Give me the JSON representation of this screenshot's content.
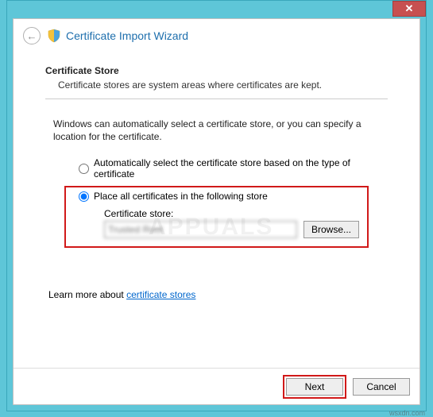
{
  "window": {
    "close_glyph": "✕"
  },
  "header": {
    "back_glyph": "←",
    "title": "Certificate Import Wizard"
  },
  "section": {
    "title": "Certificate Store",
    "desc": "Certificate stores are system areas where certificates are kept."
  },
  "instruction": "Windows can automatically select a certificate store, or you can specify a location for the certificate.",
  "radios": {
    "auto": "Automatically select the certificate store based on the type of certificate",
    "place": "Place all certificates in the following store"
  },
  "store": {
    "label": "Certificate store:",
    "value": "Trusted Root",
    "browse": "Browse..."
  },
  "learn": {
    "prefix": "Learn more about ",
    "link": "certificate stores"
  },
  "buttons": {
    "next": "Next",
    "cancel": "Cancel"
  },
  "watermark": "APPUALS",
  "sitemark": "wsxdn.com"
}
